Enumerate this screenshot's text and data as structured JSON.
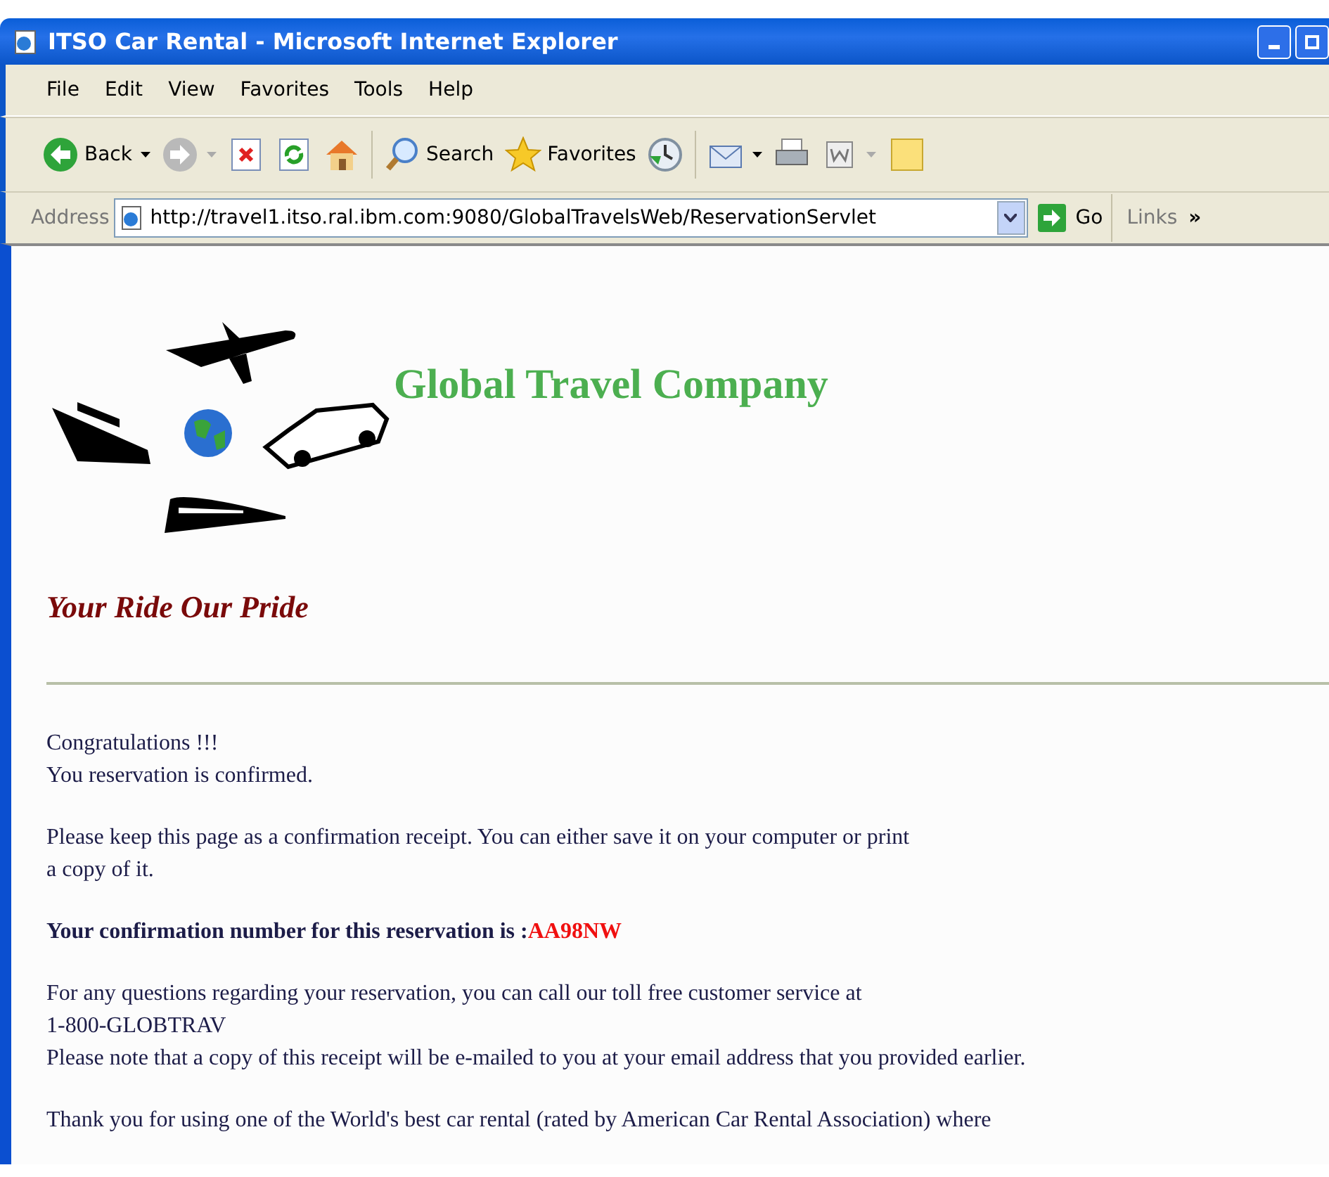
{
  "window": {
    "title": "ITSO Car Rental - Microsoft Internet Explorer"
  },
  "menu": [
    "File",
    "Edit",
    "View",
    "Favorites",
    "Tools",
    "Help"
  ],
  "toolbar": [
    {
      "kind": "back",
      "label": "Back"
    },
    {
      "kind": "forward"
    },
    {
      "kind": "stop"
    },
    {
      "kind": "refresh"
    },
    {
      "kind": "home"
    },
    {
      "kind": "search",
      "label": "Search"
    },
    {
      "kind": "favorites",
      "label": "Favorites"
    },
    {
      "kind": "history"
    },
    {
      "kind": "mail"
    },
    {
      "kind": "print"
    },
    {
      "kind": "edit"
    },
    {
      "kind": "note"
    }
  ],
  "address_bar": {
    "label": "Address",
    "value": "http://travel1.itso.ral.ibm.com:9080/GlobalTravelsWeb/ReservationServlet",
    "go": "Go",
    "links": "Links",
    "more": "»"
  },
  "page": {
    "company": "Global Travel Company",
    "tagline": "Your Ride Our Pride",
    "paragraphs": [
      {
        "kind": "lines",
        "lines": [
          "Congratulations !!!",
          "You reservation is confirmed."
        ]
      },
      {
        "kind": "lines",
        "lines": [
          "Please keep this page as a confirmation receipt. You can either save it on your computer or print",
          "a copy of it."
        ]
      },
      {
        "kind": "confirmation",
        "text": "Your confirmation number for this reservation is :",
        "number": "AA98NW"
      },
      {
        "kind": "lines",
        "lines": [
          "For any questions regarding your reservation, you can call our toll free customer service at",
          "1-800-GLOBTRAV",
          "Please note that a copy of this receipt will be e-mailed to you at your email address that you provided earlier."
        ]
      },
      {
        "kind": "lines",
        "lines": [
          "Thank you for using one of the World's best car rental (rated by American Car Rental Association) where"
        ]
      }
    ]
  }
}
